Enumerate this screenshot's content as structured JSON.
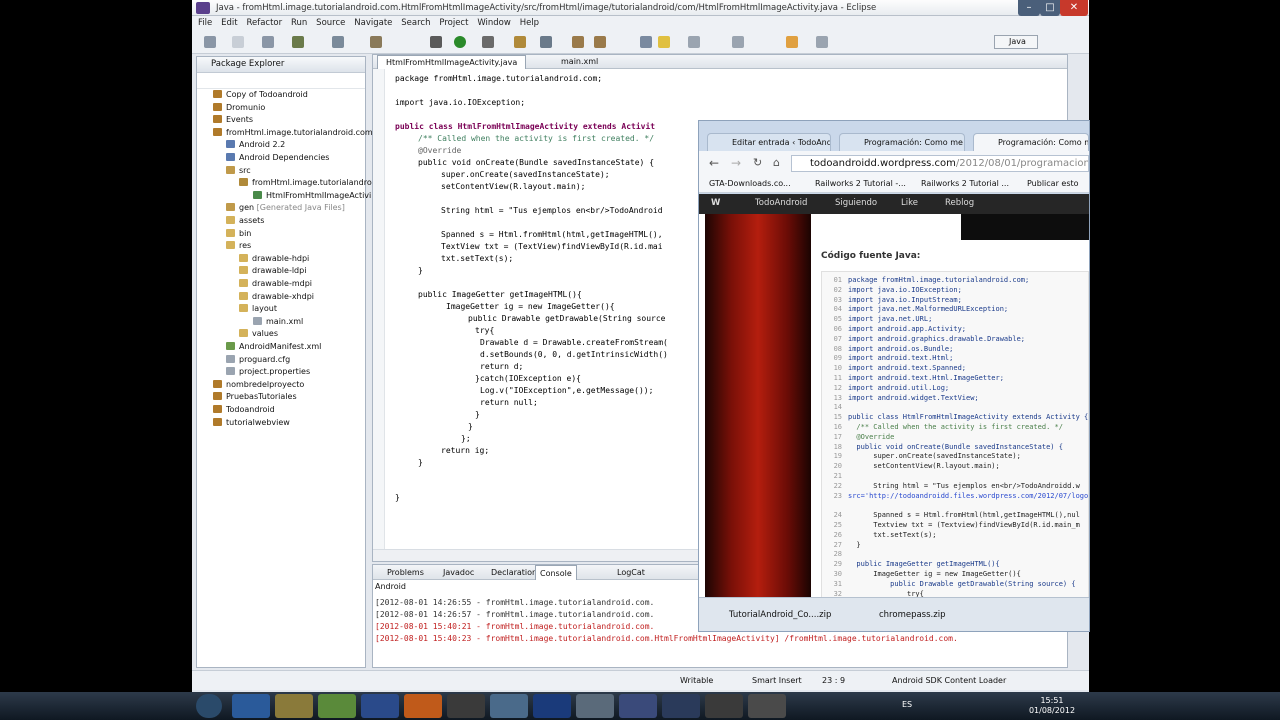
{
  "eclipse": {
    "title": "Java - fromHtml.image.tutorialandroid.com.HtmlFromHtmlImageActivity/src/fromHtml/image/tutorialandroid/com/HtmlFromHtmlImageActivity.java - Eclipse",
    "menu": [
      "File",
      "Edit",
      "Refactor",
      "Run",
      "Source",
      "Navigate",
      "Search",
      "Project",
      "Window",
      "Help"
    ],
    "perspective": "Java",
    "package_explorer": {
      "title": "Package Explorer",
      "items": [
        "Copy of Todoandroid",
        "Dromunio",
        "Events",
        "fromHtml.image.tutorialandroid.com.",
        "Android 2.2",
        "Android Dependencies",
        "src",
        "fromHtml.image.tutorialandroid",
        "HtmlFromHtmlImageActivi",
        "gen",
        "[Generated Java Files]",
        "assets",
        "bin",
        "res",
        "drawable-hdpi",
        "drawable-ldpi",
        "drawable-mdpi",
        "drawable-xhdpi",
        "layout",
        "main.xml",
        "values",
        "AndroidManifest.xml",
        "proguard.cfg",
        "project.properties",
        "nombredelproyecto",
        "PruebasTutoriales",
        "Todoandroid",
        "tutorialwebview"
      ]
    },
    "editor_tabs": [
      "HtmlFromHtmlImageActivity.java",
      "main.xml"
    ],
    "code": [
      "package fromHtml.image.tutorialandroid.com;",
      "import java.io.IOException;",
      "public class HtmlFromHtmlImageActivity extends Activit",
      "/** Called when the activity is first created. */",
      "@Override",
      "public void onCreate(Bundle savedInstanceState) {",
      "super.onCreate(savedInstanceState);",
      "setContentView(R.layout.main);",
      "String html = \"Tus ejemplos en<br/>TodoAndroid",
      "Spanned s = Html.fromHtml(html,getImageHTML(),",
      "TextView txt = (TextView)findViewById(R.id.mai",
      "txt.setText(s);",
      "}",
      "public ImageGetter getImageHTML(){",
      "ImageGetter ig = new ImageGetter(){",
      "public Drawable getDrawable(String source",
      "try{",
      "Drawable d = Drawable.createFromStream(",
      "d.setBounds(0, 0, d.getIntrinsicWidth()",
      "return d;",
      "}catch(IOException e){",
      "Log.v(\"IOException\",e.getMessage());",
      "return null;",
      "}",
      "}",
      "};",
      "return ig;",
      "}",
      "}"
    ],
    "console_tabs": [
      "Problems",
      "Javadoc",
      "Declaration",
      "Console",
      "LogCat"
    ],
    "console_label": "Android",
    "console_lines": [
      "[2012-08-01 14:26:55 - fromHtml.image.tutorialandroid.com.",
      "[2012-08-01 14:26:57 - fromHtml.image.tutorialandroid.com.",
      "[2012-08-01 15:40:21 - fromHtml.image.tutorialandroid.com.",
      "[2012-08-01 15:40:23 - fromHtml.image.tutorialandroid.com.HtmlFromHtmlImageActivity] /fromHtml.image.tutorialandroid.com."
    ],
    "status": {
      "mode": "Writable",
      "insert": "Smart Insert",
      "position": "23 : 9",
      "task": "Android SDK Content Loader"
    }
  },
  "chrome": {
    "tabs": [
      "Editar entrada ‹ TodoAndr",
      "Programación: Como me",
      "Programación: Como m"
    ],
    "url_host": "todoandroidd.wordpress.com",
    "url_path": "/2012/08/01/programacion-co",
    "bookmarks": [
      "GTA-Downloads.co...",
      "Railworks 2 Tutorial -...",
      "Railworks 2 Tutorial ...",
      "Publicar esto"
    ],
    "wpbar": [
      "TodoAndroid",
      "Siguiendo",
      "Like",
      "Reblog"
    ],
    "content_title": "Código fuente Java:",
    "snippet_numbers": [
      "01",
      "02",
      "03",
      "04",
      "05",
      "06",
      "07",
      "08",
      "09",
      "10",
      "11",
      "12",
      "13",
      "14",
      "15",
      "16",
      "17",
      "18",
      "19",
      "20",
      "21",
      "22",
      "23",
      "",
      "24",
      "25",
      "26",
      "27",
      "28",
      "29",
      "30",
      "31",
      "32"
    ],
    "snippet": [
      "package fromHtml.image.tutorialandroid.com;",
      "import java.io.IOException;",
      "import java.io.InputStream;",
      "import java.net.MalformedURLException;",
      "import java.net.URL;",
      "import android.app.Activity;",
      "import android.graphics.drawable.Drawable;",
      "import android.os.Bundle;",
      "import android.text.Html;",
      "import android.text.Spanned;",
      "import android.text.Html.ImageGetter;",
      "import android.util.Log;",
      "import android.widget.TextView;",
      "",
      "public class HtmlFromHtmlImageActivity extends Activity {",
      "  /** Called when the activity is first created. */",
      "  @Override",
      "  public void onCreate(Bundle savedInstanceState) {",
      "      super.onCreate(savedInstanceState);",
      "      setContentView(R.layout.main);",
      "",
      "      String html = \"Tus ejemplos en<br/>TodoAndroidd.w",
      "src='http://todoandroidd.files.wordpress.com/2012/07/logo",
      "",
      "      Spanned s = Html.fromHtml(html,getImageHTML(),nul",
      "      Textview txt = (Textview)findViewById(R.id.main_m",
      "      txt.setText(s);",
      "  }",
      "",
      "  public ImageGetter getImageHTML(){",
      "      ImageGetter ig = new ImageGetter(){",
      "          public Drawable getDrawable(String source) {",
      "              try{"
    ],
    "downloads": [
      "TutorialAndroid_Co....zip",
      "chromepass.zip"
    ]
  },
  "taskbar": {
    "lang": "ES",
    "time": "15:51",
    "date": "01/08/2012"
  },
  "colors": {
    "accent_editor": "#7a0055",
    "wp_bar": "#262626",
    "taskbar": "#1c2733"
  }
}
